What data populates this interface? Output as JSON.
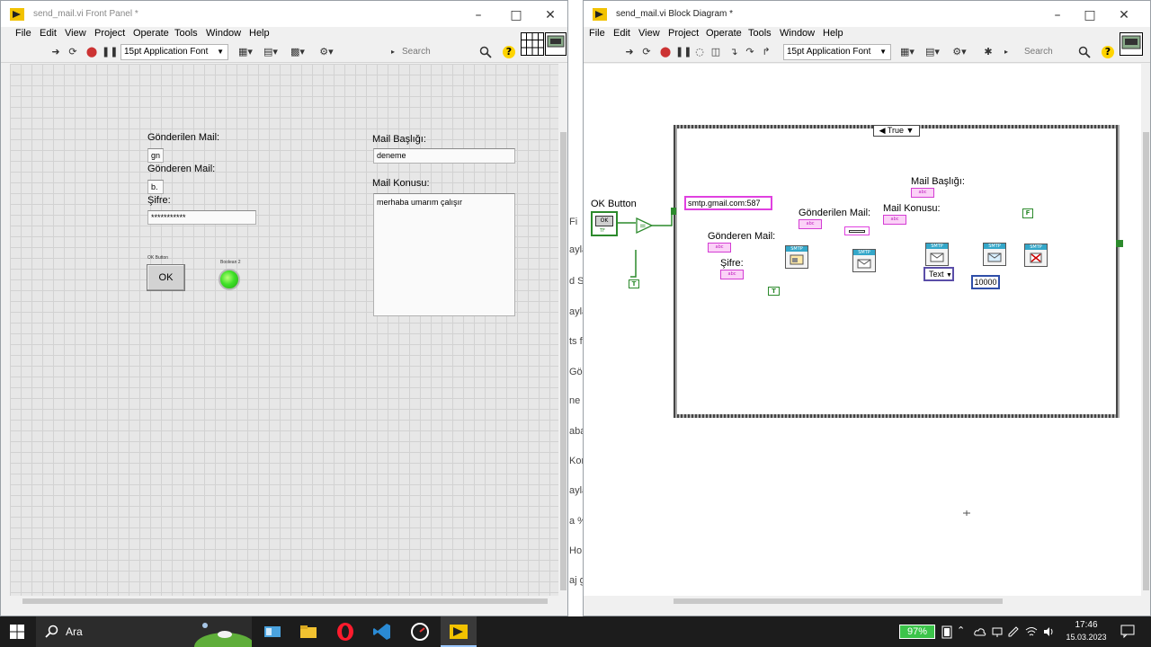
{
  "desktop_ghost": [
    "Fi",
    "ayla",
    "d S",
    "ayla",
    "ts f",
    "Gön",
    "ne D",
    "aba",
    "Kor",
    "ayla",
    "a %",
    "Ho",
    "aj g"
  ],
  "front_panel": {
    "title": "send_mail.vi Front Panel *",
    "menu": [
      "File",
      "Edit",
      "View",
      "Project",
      "Operate",
      "Tools",
      "Window",
      "Help"
    ],
    "font": "15pt Application Font",
    "search_placeholder": "Search",
    "help_glyph": "?",
    "controls": {
      "sent_mail_label": "Gönderilen Mail:",
      "sent_mail_value": "gn",
      "sender_mail_label": "Gönderen Mail:",
      "sender_mail_value": "b.",
      "password_label": "Şifre:",
      "password_value": "***********",
      "ok_button_caption": "OK Button",
      "ok_button_text": "OK",
      "boolean_caption": "Boolean 2",
      "mail_subject_label": "Mail Başlığı:",
      "mail_subject_value": "deneme",
      "mail_body_label": "Mail Konusu:",
      "mail_body_value": "merhaba umarım çalışır"
    }
  },
  "block_diagram": {
    "title": "send_mail.vi Block Diagram *",
    "menu": [
      "File",
      "Edit",
      "View",
      "Project",
      "Operate",
      "Tools",
      "Window",
      "Help"
    ],
    "font": "15pt Application Font",
    "search_placeholder": "Search",
    "help_glyph": "?",
    "case_selector": "True",
    "ok_button_label": "OK Button",
    "ok_term_text": "OK",
    "tf_text": "TF",
    "equal_glyph": "=",
    "true_glyph": "T",
    "false_glyph": "F",
    "smtp_server": "smtp.gmail.com:587",
    "sender_mail_label": "Gönderen Mail:",
    "password_label": "Şifre:",
    "sent_mail_label": "Gönderilen Mail:",
    "mail_body_label": "Mail Konusu:",
    "mail_subject_label": "Mail Başlığı:",
    "abc": "abc",
    "smtp_header": "SMTP",
    "text_enum": "Text",
    "timeout": "10000"
  },
  "taskbar": {
    "search_text": "Ara",
    "battery": "97%",
    "time": "17:46",
    "date": "15.03.2023"
  },
  "colors": {
    "labview_pink": "#e040e0",
    "labview_green": "#2c8a2c",
    "labview_blue": "#2f4ea8",
    "smtp_header": "#34a7c9",
    "led_on": "#3fe028"
  }
}
